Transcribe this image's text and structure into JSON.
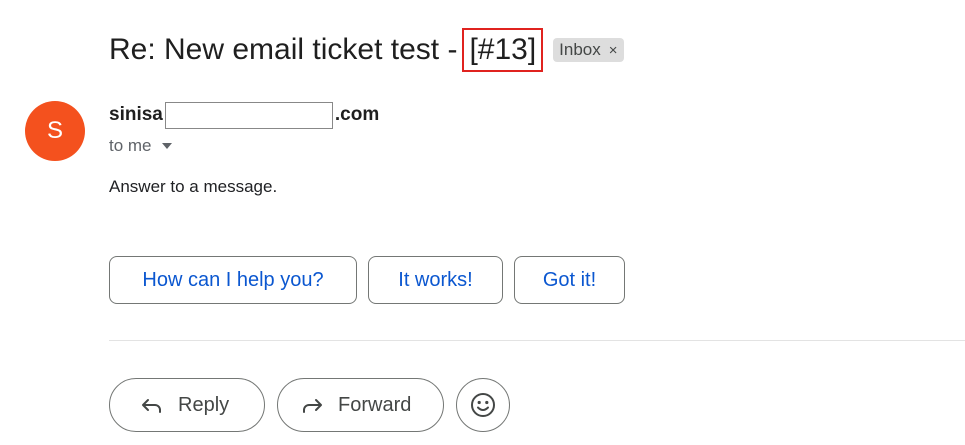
{
  "email": {
    "subject_prefix": "Re: New email ticket test -",
    "ticket_id": "[#13]",
    "label": "Inbox",
    "label_remove": "×",
    "sender": {
      "avatar_letter": "S",
      "avatar_color": "#f4511e",
      "name_start": "sinisa",
      "name_end": ".com"
    },
    "recipient": "to me",
    "body": "Answer to a message."
  },
  "smart_replies": [
    "How can I help you?",
    "It works!",
    "Got it!"
  ],
  "actions": {
    "reply_label": "Reply",
    "forward_label": "Forward"
  },
  "colors": {
    "accent_blue": "#0b57d0",
    "highlight_red": "#e0231f"
  },
  "icons": {
    "reply": "reply-arrow-icon",
    "forward": "forward-arrow-icon",
    "emoji": "smiley-face-icon",
    "recipient_menu": "chevron-down-icon"
  }
}
